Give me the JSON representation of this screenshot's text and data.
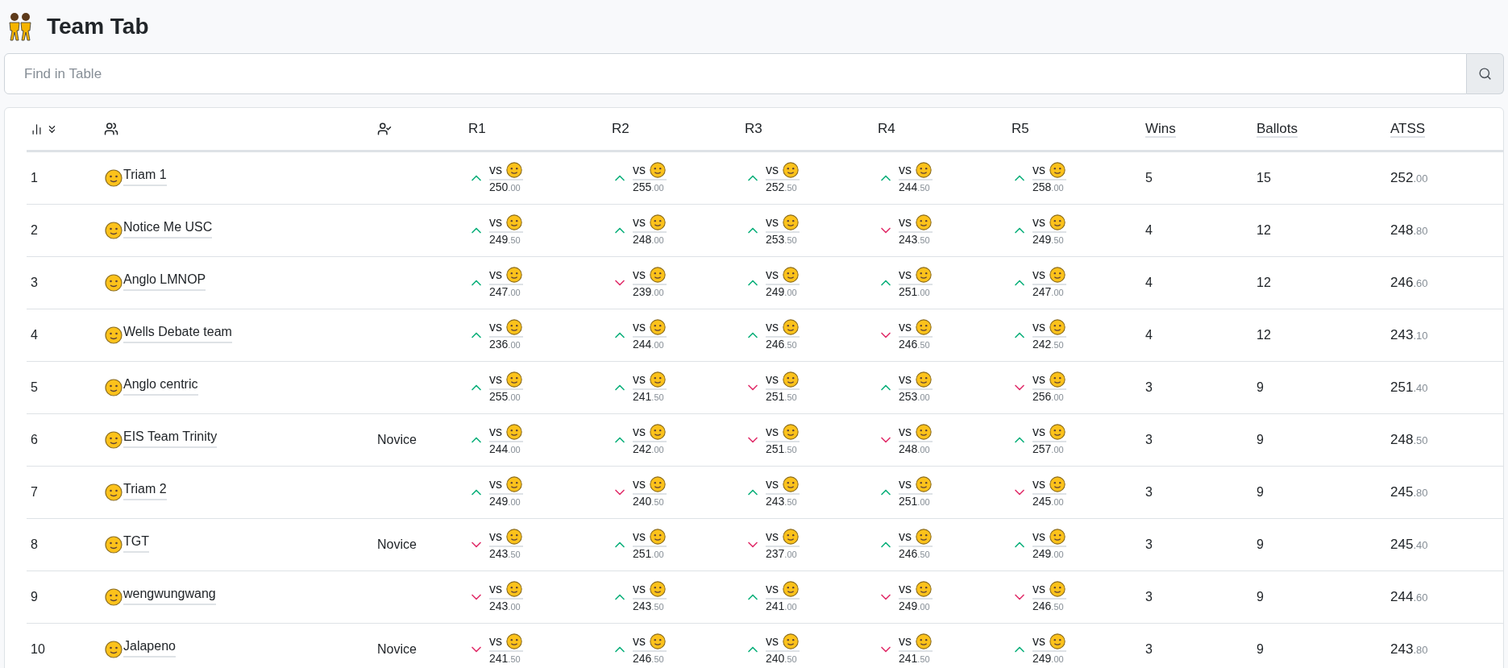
{
  "page": {
    "title": "Team Tab"
  },
  "search": {
    "placeholder": "Find in Table"
  },
  "table": {
    "columns": [
      {
        "label": "R1",
        "underlined": false
      },
      {
        "label": "R2",
        "underlined": false
      },
      {
        "label": "R3",
        "underlined": false
      },
      {
        "label": "R4",
        "underlined": false
      },
      {
        "label": "R5",
        "underlined": false
      },
      {
        "label": "Wins",
        "underlined": true
      },
      {
        "label": "Ballots",
        "underlined": true
      },
      {
        "label": "ATSS",
        "underlined": true
      }
    ],
    "rows": [
      {
        "rank": "1",
        "team": "Triam 1",
        "category": "",
        "rounds": [
          {
            "vs": "vs",
            "won": true,
            "score": "250",
            "fraction": ".00"
          },
          {
            "vs": "vs",
            "won": true,
            "score": "255",
            "fraction": ".00"
          },
          {
            "vs": "vs",
            "won": true,
            "score": "252",
            "fraction": ".50"
          },
          {
            "vs": "vs",
            "won": true,
            "score": "244",
            "fraction": ".50"
          },
          {
            "vs": "vs",
            "won": true,
            "score": "258",
            "fraction": ".00"
          }
        ],
        "wins": "5",
        "ballots": "15",
        "atss": "252",
        "atss_fraction": ".00"
      },
      {
        "rank": "2",
        "team": "Notice Me USC",
        "category": "",
        "rounds": [
          {
            "vs": "vs",
            "won": true,
            "score": "249",
            "fraction": ".50"
          },
          {
            "vs": "vs",
            "won": true,
            "score": "248",
            "fraction": ".00"
          },
          {
            "vs": "vs",
            "won": true,
            "score": "253",
            "fraction": ".50"
          },
          {
            "vs": "vs",
            "won": false,
            "score": "243",
            "fraction": ".50"
          },
          {
            "vs": "vs",
            "won": true,
            "score": "249",
            "fraction": ".50"
          }
        ],
        "wins": "4",
        "ballots": "12",
        "atss": "248",
        "atss_fraction": ".80"
      },
      {
        "rank": "3",
        "team": "Anglo LMNOP",
        "category": "",
        "rounds": [
          {
            "vs": "vs",
            "won": true,
            "score": "247",
            "fraction": ".00"
          },
          {
            "vs": "vs",
            "won": false,
            "score": "239",
            "fraction": ".00"
          },
          {
            "vs": "vs",
            "won": true,
            "score": "249",
            "fraction": ".00"
          },
          {
            "vs": "vs",
            "won": true,
            "score": "251",
            "fraction": ".00"
          },
          {
            "vs": "vs",
            "won": true,
            "score": "247",
            "fraction": ".00"
          }
        ],
        "wins": "4",
        "ballots": "12",
        "atss": "246",
        "atss_fraction": ".60"
      },
      {
        "rank": "4",
        "team": "Wells Debate team",
        "category": "",
        "rounds": [
          {
            "vs": "vs",
            "won": true,
            "score": "236",
            "fraction": ".00"
          },
          {
            "vs": "vs",
            "won": true,
            "score": "244",
            "fraction": ".00"
          },
          {
            "vs": "vs",
            "won": true,
            "score": "246",
            "fraction": ".50"
          },
          {
            "vs": "vs",
            "won": false,
            "score": "246",
            "fraction": ".50"
          },
          {
            "vs": "vs",
            "won": true,
            "score": "242",
            "fraction": ".50"
          }
        ],
        "wins": "4",
        "ballots": "12",
        "atss": "243",
        "atss_fraction": ".10"
      },
      {
        "rank": "5",
        "team": "Anglo centric",
        "category": "",
        "rounds": [
          {
            "vs": "vs",
            "won": true,
            "score": "255",
            "fraction": ".00"
          },
          {
            "vs": "vs",
            "won": true,
            "score": "241",
            "fraction": ".50"
          },
          {
            "vs": "vs",
            "won": false,
            "score": "251",
            "fraction": ".50"
          },
          {
            "vs": "vs",
            "won": true,
            "score": "253",
            "fraction": ".00"
          },
          {
            "vs": "vs",
            "won": false,
            "score": "256",
            "fraction": ".00"
          }
        ],
        "wins": "3",
        "ballots": "9",
        "atss": "251",
        "atss_fraction": ".40"
      },
      {
        "rank": "6",
        "team": "EIS Team Trinity",
        "category": "Novice",
        "rounds": [
          {
            "vs": "vs",
            "won": true,
            "score": "244",
            "fraction": ".00"
          },
          {
            "vs": "vs",
            "won": true,
            "score": "242",
            "fraction": ".00"
          },
          {
            "vs": "vs",
            "won": false,
            "score": "251",
            "fraction": ".50"
          },
          {
            "vs": "vs",
            "won": false,
            "score": "248",
            "fraction": ".00"
          },
          {
            "vs": "vs",
            "won": true,
            "score": "257",
            "fraction": ".00"
          }
        ],
        "wins": "3",
        "ballots": "9",
        "atss": "248",
        "atss_fraction": ".50"
      },
      {
        "rank": "7",
        "team": "Triam 2",
        "category": "",
        "rounds": [
          {
            "vs": "vs",
            "won": true,
            "score": "249",
            "fraction": ".00"
          },
          {
            "vs": "vs",
            "won": false,
            "score": "240",
            "fraction": ".50"
          },
          {
            "vs": "vs",
            "won": true,
            "score": "243",
            "fraction": ".50"
          },
          {
            "vs": "vs",
            "won": true,
            "score": "251",
            "fraction": ".00"
          },
          {
            "vs": "vs",
            "won": false,
            "score": "245",
            "fraction": ".00"
          }
        ],
        "wins": "3",
        "ballots": "9",
        "atss": "245",
        "atss_fraction": ".80"
      },
      {
        "rank": "8",
        "team": "TGT",
        "category": "Novice",
        "rounds": [
          {
            "vs": "vs",
            "won": false,
            "score": "243",
            "fraction": ".50"
          },
          {
            "vs": "vs",
            "won": true,
            "score": "251",
            "fraction": ".00"
          },
          {
            "vs": "vs",
            "won": false,
            "score": "237",
            "fraction": ".00"
          },
          {
            "vs": "vs",
            "won": true,
            "score": "246",
            "fraction": ".50"
          },
          {
            "vs": "vs",
            "won": true,
            "score": "249",
            "fraction": ".00"
          }
        ],
        "wins": "3",
        "ballots": "9",
        "atss": "245",
        "atss_fraction": ".40"
      },
      {
        "rank": "9",
        "team": "wengwungwang",
        "category": "",
        "rounds": [
          {
            "vs": "vs",
            "won": false,
            "score": "243",
            "fraction": ".00"
          },
          {
            "vs": "vs",
            "won": true,
            "score": "243",
            "fraction": ".50"
          },
          {
            "vs": "vs",
            "won": true,
            "score": "241",
            "fraction": ".00"
          },
          {
            "vs": "vs",
            "won": false,
            "score": "249",
            "fraction": ".00"
          },
          {
            "vs": "vs",
            "won": false,
            "score": "246",
            "fraction": ".50"
          }
        ],
        "wins": "3",
        "ballots": "9",
        "atss": "244",
        "atss_fraction": ".60"
      },
      {
        "rank": "10",
        "team": "Jalapeno",
        "category": "Novice",
        "rounds": [
          {
            "vs": "vs",
            "won": false,
            "score": "241",
            "fraction": ".50"
          },
          {
            "vs": "vs",
            "won": true,
            "score": "246",
            "fraction": ".50"
          },
          {
            "vs": "vs",
            "won": true,
            "score": "240",
            "fraction": ".50"
          },
          {
            "vs": "vs",
            "won": false,
            "score": "241",
            "fraction": ".50"
          },
          {
            "vs": "vs",
            "won": true,
            "score": "249",
            "fraction": ".00"
          }
        ],
        "wins": "3",
        "ballots": "9",
        "atss": "243",
        "atss_fraction": ".80"
      }
    ]
  }
}
